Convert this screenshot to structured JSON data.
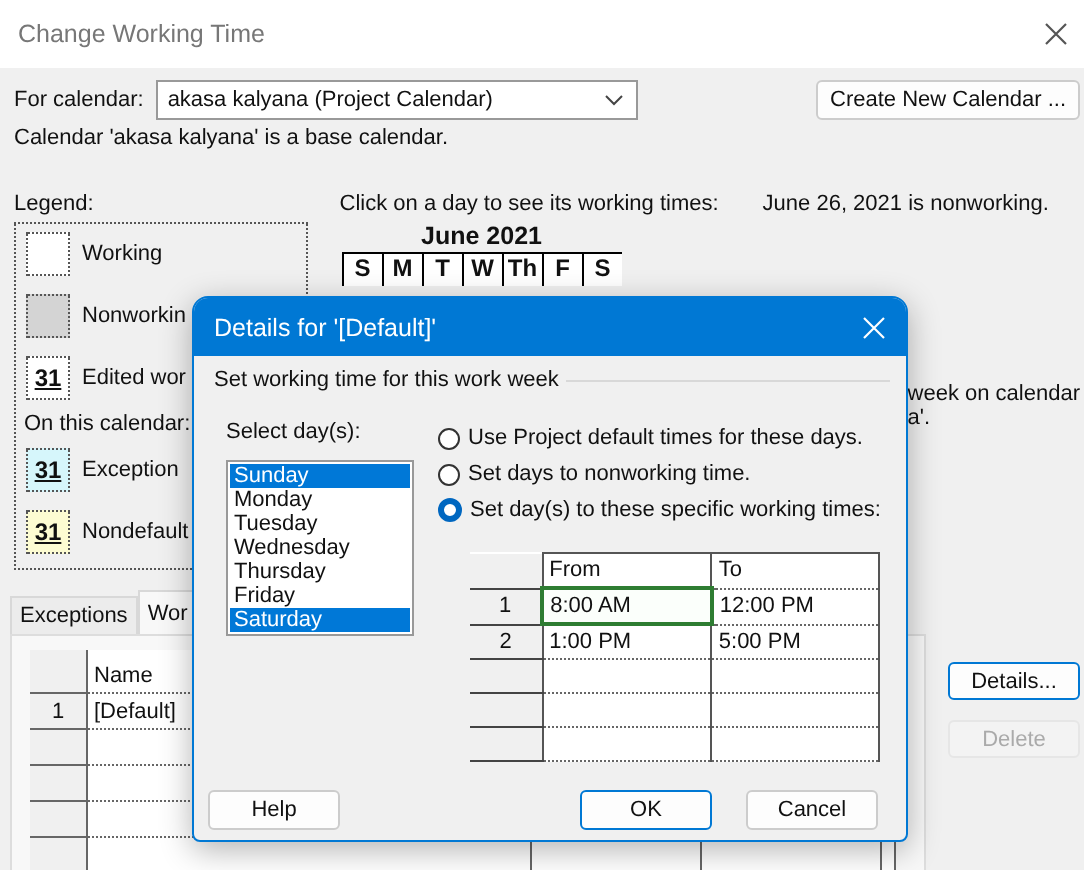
{
  "window": {
    "title": "Change Working Time"
  },
  "for_calendar": {
    "label": "For calendar:",
    "value": "akasa kalyana (Project Calendar)"
  },
  "create_button": "Create New Calendar ...",
  "calendar_note": "Calendar 'akasa kalyana' is a base calendar.",
  "legend": {
    "title": "Legend:",
    "items": [
      {
        "kind": "working",
        "label": "Working"
      },
      {
        "kind": "nonworking",
        "label": "Nonworkin"
      },
      {
        "kind": "edited",
        "glyph": "31",
        "label": "Edited wor"
      },
      {
        "kind": "heading",
        "label": "On this calendar:"
      },
      {
        "kind": "exception",
        "glyph": "31",
        "label": "Exception"
      },
      {
        "kind": "nondefault",
        "glyph": "31",
        "label": "Nondefault"
      }
    ]
  },
  "calendar": {
    "instruction": "Click on a day to see its working times:",
    "status": "June 26, 2021 is nonworking.",
    "month": "June 2021",
    "weekdays": [
      "S",
      "M",
      "T",
      "W",
      "Th",
      "F",
      "S"
    ]
  },
  "side_text": [
    "week on calendar",
    "a'."
  ],
  "tabs": [
    {
      "label": "Exceptions",
      "selected": false
    },
    {
      "label": "Wor",
      "selected": true
    }
  ],
  "grid": {
    "columns": [
      "Name"
    ],
    "rows": [
      {
        "number": "1",
        "name": "[Default]"
      }
    ]
  },
  "side_buttons": [
    {
      "label": "Details...",
      "disabled": false
    },
    {
      "label": "Delete",
      "disabled": true
    }
  ],
  "dialog": {
    "title": "Details for '[Default]'",
    "group": "Set working time for this work week",
    "days_label": "Select day(s):",
    "days": [
      {
        "label": "Sunday",
        "selected": true
      },
      {
        "label": "Monday",
        "selected": false
      },
      {
        "label": "Tuesday",
        "selected": false
      },
      {
        "label": "Wednesday",
        "selected": false
      },
      {
        "label": "Thursday",
        "selected": false
      },
      {
        "label": "Friday",
        "selected": false
      },
      {
        "label": "Saturday",
        "selected": true
      }
    ],
    "options": [
      {
        "label": "Use Project default times for these days.",
        "selected": false
      },
      {
        "label": "Set days to nonworking time.",
        "selected": false
      },
      {
        "label": "Set day(s) to these specific working times:",
        "selected": true
      }
    ],
    "times": {
      "columns": [
        "From",
        "To"
      ],
      "rows": [
        {
          "number": "1",
          "from": "8:00 AM",
          "to": "12:00 PM",
          "from_active": true
        },
        {
          "number": "2",
          "from": "1:00 PM",
          "to": "5:00 PM",
          "from_active": false
        }
      ]
    },
    "buttons": [
      {
        "label": "Help",
        "default": false
      },
      {
        "label": "OK",
        "default": true
      },
      {
        "label": "Cancel",
        "default": false
      }
    ]
  }
}
